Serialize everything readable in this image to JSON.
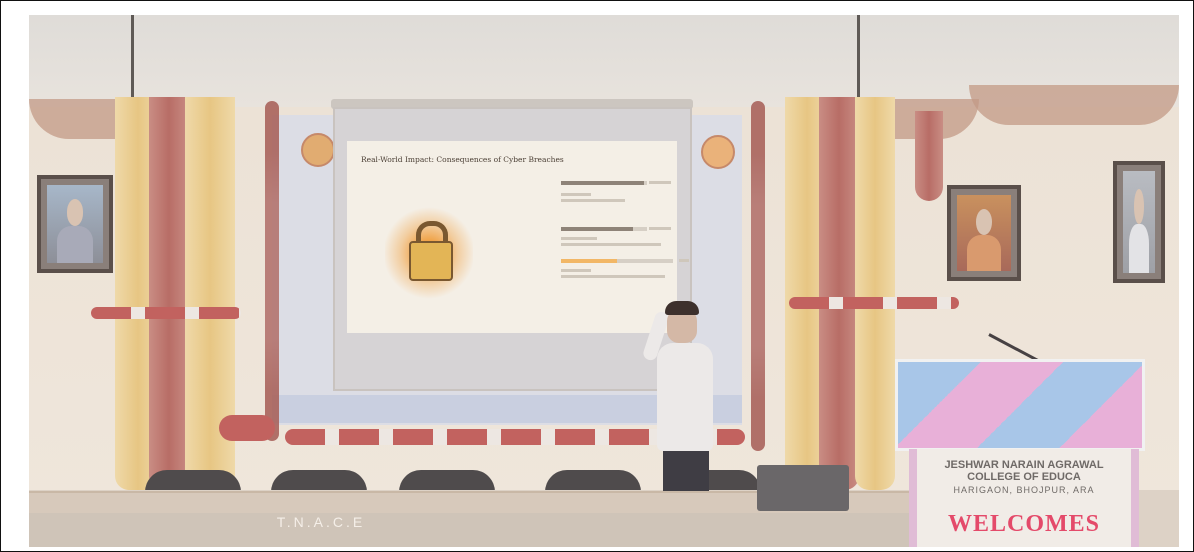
{
  "slide": {
    "title": "Real-World Impact: Consequences of Cyber Breaches",
    "progress_levels": [
      0.97,
      0.84,
      0.5
    ]
  },
  "stage": {
    "front_text": "T.N.A.C.E"
  },
  "lectern": {
    "college_name": "JESHWAR NARAIN AGRAWAL COLLEGE OF EDUCA",
    "address": "HARIGAON, BHOJPUR, ARA",
    "welcome": "WELCOMES"
  },
  "colors": {
    "accent_orange": "#f0a44a",
    "bar_dark": "#8e8378",
    "bar_orange": "#f2b766",
    "welcome_pink": "#e44a6a"
  }
}
